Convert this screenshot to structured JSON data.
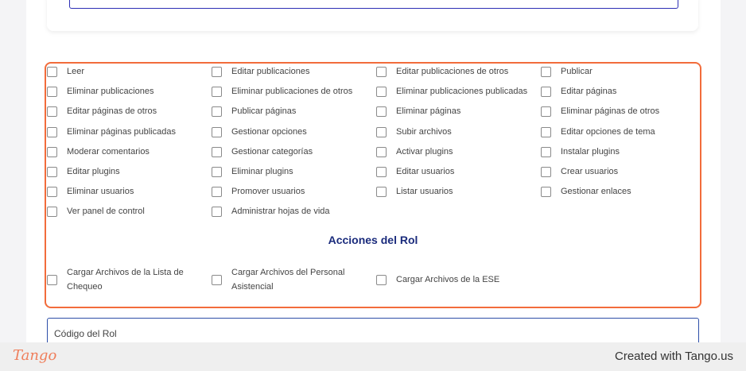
{
  "permissions": [
    [
      "Leer",
      "Editar publicaciones",
      "Editar publicaciones de otros",
      "Publicar"
    ],
    [
      "Eliminar publicaciones",
      "Eliminar publicaciones de otros",
      "Eliminar publicaciones publicadas",
      "Editar páginas"
    ],
    [
      "Editar páginas de otros",
      "Publicar páginas",
      "Eliminar páginas",
      "Eliminar páginas de otros"
    ],
    [
      "Eliminar páginas publicadas",
      "Gestionar opciones",
      "Subir archivos",
      "Editar opciones de tema"
    ],
    [
      "Moderar comentarios",
      "Gestionar categorías",
      "Activar plugins",
      "Instalar plugins"
    ],
    [
      "Editar plugins",
      "Eliminar plugins",
      "Editar usuarios",
      "Crear usuarios"
    ],
    [
      "Eliminar usuarios",
      "Promover usuarios",
      "Listar usuarios",
      "Gestionar enlaces"
    ],
    [
      "Ver panel de control",
      "Administrar hojas de vida"
    ]
  ],
  "role_actions": {
    "title": "Acciones del Rol",
    "items": [
      "Cargar Archivos de la Lista de Chequeo",
      "Cargar Archivos del Personal Asistencial",
      "Cargar Archivos de la ESE"
    ]
  },
  "role_code": {
    "label": "Código del Rol"
  },
  "footer": {
    "logo": "Tango",
    "credit": "Created with Tango.us"
  },
  "colors": {
    "highlight": "#f26c3b",
    "title": "#1a2b7c",
    "field_border": "#2d4ea8"
  }
}
